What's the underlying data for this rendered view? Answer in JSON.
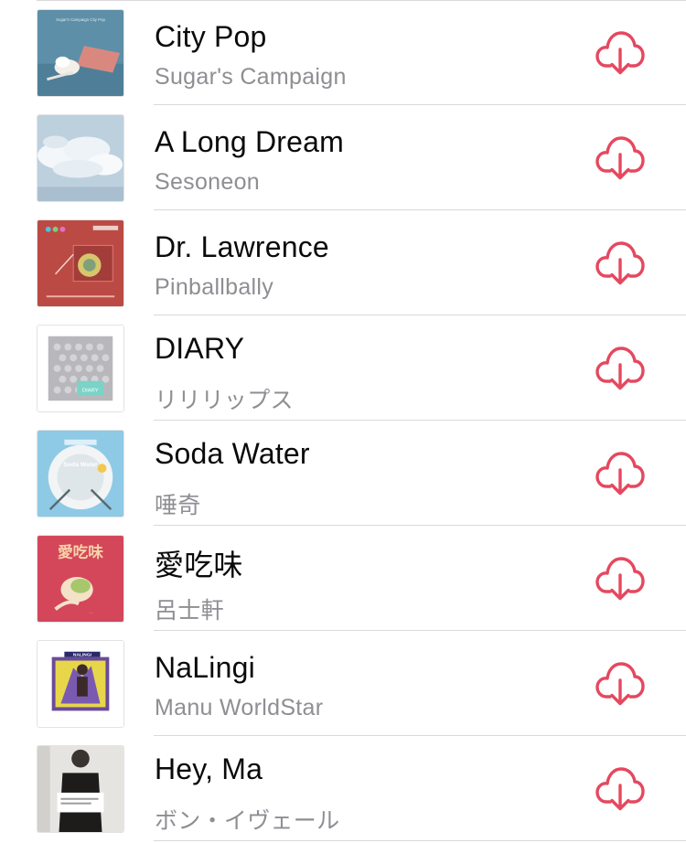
{
  "colors": {
    "accent": "#e5485f",
    "title": "#0a0a0a",
    "subtitle": "#8e8e93",
    "separator": "#d9d9dc"
  },
  "songs": [
    {
      "title": "City Pop",
      "artist": "Sugar's Campaign",
      "artwork_icon": "city-pop-artwork",
      "artwork_text": "Sugar's Campaign City Pop",
      "action_icon": "cloud-download-icon"
    },
    {
      "title": "A Long Dream",
      "artist": "Sesoneon",
      "artwork_icon": "a-long-dream-artwork",
      "action_icon": "cloud-download-icon"
    },
    {
      "title": "Dr. Lawrence",
      "artist": "Pinballbally",
      "artwork_icon": "dr-lawrence-artwork",
      "action_icon": "cloud-download-icon"
    },
    {
      "title": "DIARY",
      "artist": "リリリップス",
      "artwork_icon": "diary-artwork",
      "artwork_text": "DIARY",
      "action_icon": "cloud-download-icon"
    },
    {
      "title": "Soda Water",
      "artist": "唾奇",
      "artwork_icon": "soda-water-artwork",
      "artwork_text": "Soda Water",
      "action_icon": "cloud-download-icon"
    },
    {
      "title": "愛吃味",
      "artist": "呂士軒",
      "artwork_icon": "ai-chi-wei-artwork",
      "artwork_text": "愛吃味",
      "action_icon": "cloud-download-icon"
    },
    {
      "title": "NaLingi",
      "artist": "Manu WorldStar",
      "artwork_icon": "nalingi-artwork",
      "artwork_text": "NALINGI",
      "action_icon": "cloud-download-icon"
    },
    {
      "title": "Hey, Ma",
      "artist": "ボン・イヴェール",
      "artwork_icon": "hey-ma-artwork",
      "action_icon": "cloud-download-icon"
    }
  ]
}
